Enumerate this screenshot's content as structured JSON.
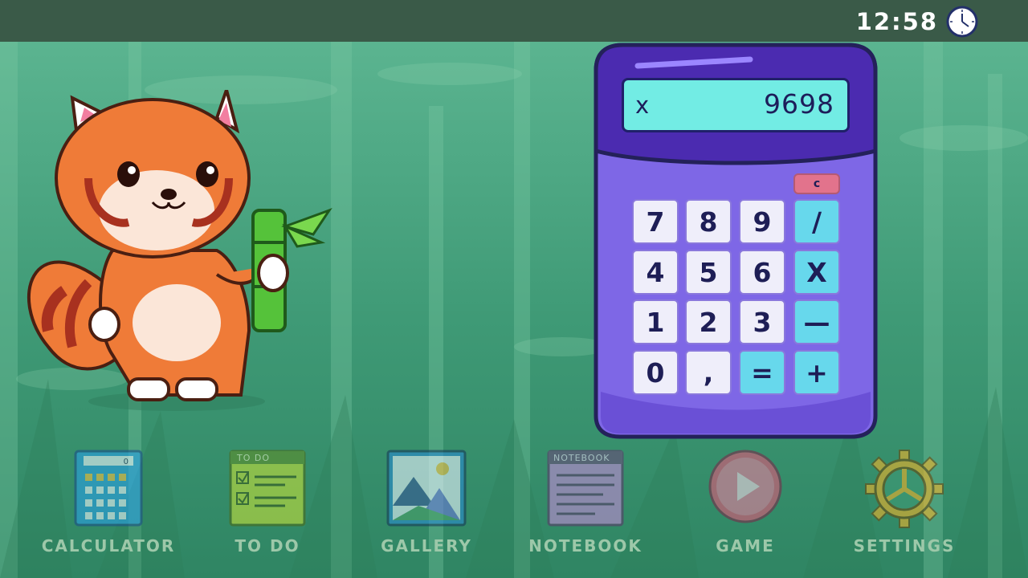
{
  "status_bar": {
    "time": "12:58"
  },
  "calculator": {
    "display_operator": "x",
    "display_value": "9698",
    "clear_label": "c",
    "keys": [
      {
        "label": "7",
        "type": "num"
      },
      {
        "label": "8",
        "type": "num"
      },
      {
        "label": "9",
        "type": "num"
      },
      {
        "label": "/",
        "type": "op"
      },
      {
        "label": "4",
        "type": "num"
      },
      {
        "label": "5",
        "type": "num"
      },
      {
        "label": "6",
        "type": "num"
      },
      {
        "label": "X",
        "type": "op"
      },
      {
        "label": "1",
        "type": "num"
      },
      {
        "label": "2",
        "type": "num"
      },
      {
        "label": "3",
        "type": "num"
      },
      {
        "label": "—",
        "type": "op"
      },
      {
        "label": "0",
        "type": "num"
      },
      {
        "label": ",",
        "type": "num"
      },
      {
        "label": "=",
        "type": "op"
      },
      {
        "label": "+",
        "type": "op"
      }
    ],
    "colors": {
      "body": "#7e67e6",
      "frame": "#4b2bb0",
      "screen": "#72ece4",
      "op_key": "#67d8ec",
      "clear_key": "#e2738c"
    }
  },
  "dock": {
    "items": [
      {
        "label": "CALCULATOR",
        "icon": "calculator-icon",
        "mini_display": "0"
      },
      {
        "label": "TO DO",
        "icon": "todo-icon",
        "header": "TO DO"
      },
      {
        "label": "GALLERY",
        "icon": "gallery-icon"
      },
      {
        "label": "NOTEBOOK",
        "icon": "notebook-icon",
        "header": "NOTEBOOK"
      },
      {
        "label": "GAME",
        "icon": "play-icon"
      },
      {
        "label": "SETTINGS",
        "icon": "gear-icon"
      }
    ]
  }
}
